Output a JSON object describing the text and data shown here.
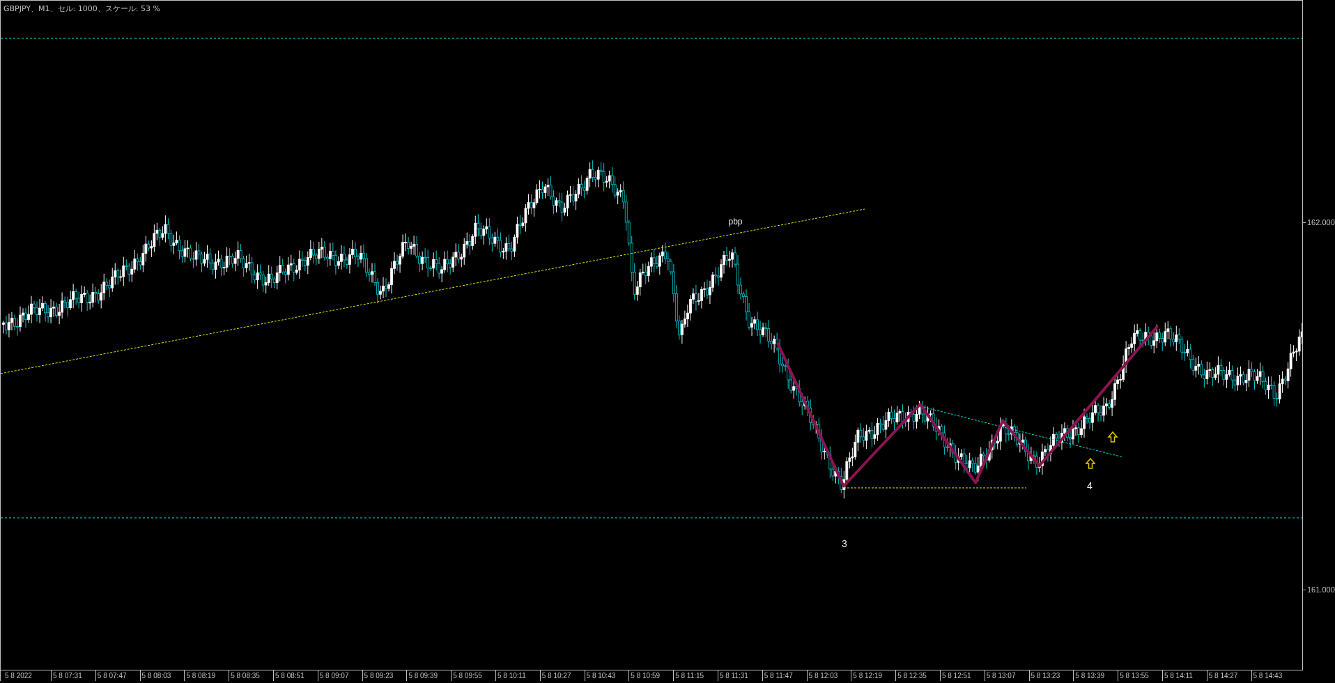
{
  "chart_title": "GBPJPY、M1、セル: 1000、スケール: 53 %",
  "price_axis": [
    {
      "label": "162.000"
    },
    {
      "label": "161.000"
    }
  ],
  "time_axis": [
    "5 8 2022",
    "5 8 07:31",
    "5 8 07:47",
    "5 8 08:03",
    "5 8 08:19",
    "5 8 08:35",
    "5 8 08:51",
    "5 8 09:07",
    "5 8 09:23",
    "5 8 09:39",
    "5 8 09:55",
    "5 8 10:11",
    "5 8 10:27",
    "5 8 10:43",
    "5 8 10:59",
    "5 8 11:15",
    "5 8 11:31",
    "5 8 11:47",
    "5 8 12:03",
    "5 8 12:19",
    "5 8 12:35",
    "5 8 12:51",
    "5 8 13:07",
    "5 8 13:23",
    "5 8 13:39",
    "5 8 13:55",
    "5 8 14:11",
    "5 8 14:27",
    "5 8 14:43"
  ],
  "annotations": [
    {
      "text": "pbp"
    },
    {
      "text": "3"
    },
    {
      "text": "4"
    }
  ]
}
